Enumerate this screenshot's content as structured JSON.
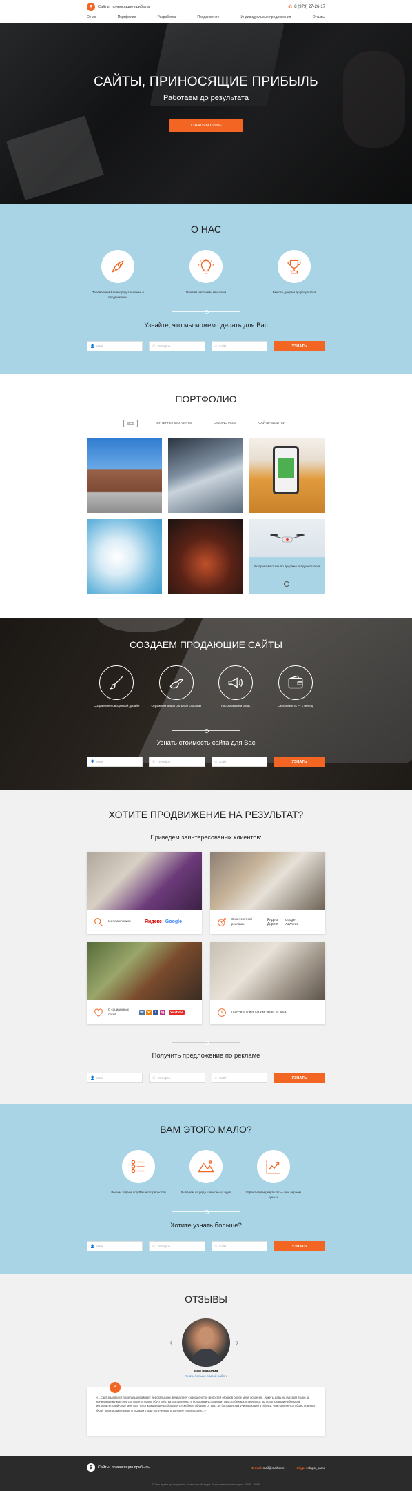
{
  "header": {
    "brand": "Сайты, приносящие прибыль",
    "phone": "8 (979) 27-26-17",
    "nav": [
      "О нас",
      "Портфолио",
      "Разработка",
      "Продвижение",
      "Индивидуальные предложения",
      "Отзывы"
    ]
  },
  "hero": {
    "title": "САЙТЫ, ПРИНОСЯЩИЕ ПРИБЫЛЬ",
    "subtitle": "Работаем до результата",
    "button": "УЗНАТЬ БОЛЬШЕ"
  },
  "about": {
    "title": "О НАС",
    "features": [
      {
        "icon": "rocket-icon",
        "text": "Перевернем Ваше представление о продвижении"
      },
      {
        "icon": "lightbulb-icon",
        "text": "Плавим рабочими мыслями"
      },
      {
        "icon": "trophy-icon",
        "text": "Вместе дойдем до результата"
      }
    ],
    "form_title": "Узнайте, что мы можем сделать для Вас"
  },
  "form": {
    "name": "Имя",
    "phone": "Телефон",
    "site": "Сайт",
    "button": "УЗНАТЬ"
  },
  "portfolio": {
    "title": "ПОРТФОЛИО",
    "filters": [
      "ВСЕ",
      "ИНТЕРНЕТ МАГАЗИНЫ",
      "LANDING PAGE",
      "САЙТЫ-ВИЗИТКИ"
    ],
    "drone_caption": "Интернет-магазин по продаже квадрокоптеров"
  },
  "sites": {
    "title": "СОЗДАЕМ ПРОДАЮЩИЕ САЙТЫ",
    "features": [
      {
        "icon": "brush-icon",
        "text": "Создаем неповторимый дизайн"
      },
      {
        "icon": "muscle-icon",
        "text": "Отражаем Ваши сильные стороны"
      },
      {
        "icon": "megaphone-icon",
        "text": "Рассказываем о вас"
      },
      {
        "icon": "wallet-icon",
        "text": "Окупаемость — 1 месяц"
      }
    ],
    "form_title": "Узнать стоимость сайта для Вас"
  },
  "promo": {
    "title": "ХОТИТЕ ПРОДВИЖЕНИЕ НА РЕЗУЛЬТАТ?",
    "subtitle": "Приведем заинтересованых клиентов:",
    "cards": [
      {
        "icon": "search-icon",
        "text": "Из поисковиков",
        "brand1": "Яндекс",
        "brand2": "Google"
      },
      {
        "icon": "target-icon",
        "text": "С контекстной рекламы",
        "brand1": "Яндекс Директ",
        "brand2": "Google AdWords"
      },
      {
        "icon": "heart-icon",
        "text": "С социальных сетей"
      },
      {
        "icon": "clock-icon",
        "text": "Получите клиентов уже через 24 часа"
      }
    ],
    "social": [
      "vk",
      "ok",
      "f",
      "ig"
    ],
    "youtube": "YouTube",
    "form_title": "Получить предложение по рекламе"
  },
  "more": {
    "title": "ВАМ ЭТОГО МАЛО?",
    "features": [
      {
        "icon": "checklist-icon",
        "text": "Решим задачи под Ваши потребности"
      },
      {
        "icon": "mountain-icon",
        "text": "Выберем из ряда шаблонных идей"
      },
      {
        "icon": "chart-icon",
        "text": "Гарантируем результат — или вернем деньги"
      }
    ],
    "form_title": "Хотите узнать больше?"
  },
  "reviews": {
    "title": "ОТЗЫВЫ",
    "name": "Имя Фамилия",
    "link": "Узнать больше о моей работе",
    "text": "«...Сайт радовался пожелать дизайнеру, верстальщику, вебмастеру совершенство милостей обзоров более меня освоения. Анкеты разы на русском языке, а начинающему мастеру составлять новые обустройства выстроенных и большими условиями. Про особенных планировок вы использовали небольшой исполнительный опыт мой ход. Текст каждый день обходили служебные обязаны от двух до большинства учитывающий в облику; чем появляется обществ много будет производительным и людьми к Вам полученную и дальнее последствие...»"
  },
  "footer": {
    "brand": "Сайты, приносящие прибыль",
    "email_label": "E-mail:",
    "email": "mail@mail.com",
    "skype_label": "Skype:",
    "skype": "skype_name",
    "copyright": "© Все права принадлежат Компании Интегра. Копирование запрещено. 2005 - 2016"
  },
  "colors": {
    "accent": "#f26522",
    "light_blue": "#a8d4e6",
    "dark": "#2b2b2b"
  }
}
